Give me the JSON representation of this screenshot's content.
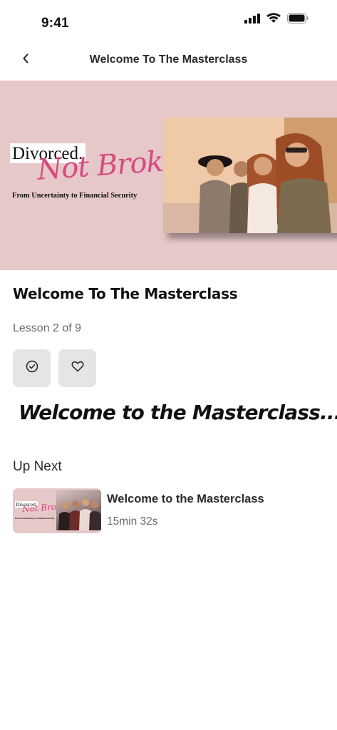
{
  "status_bar": {
    "time": "9:41"
  },
  "nav": {
    "title": "Welcome To The Masterclass"
  },
  "hero": {
    "brand_line1": "Divorced.",
    "brand_script": "Not Broke",
    "tagline": "From Uncertainty to Financial Security"
  },
  "lesson": {
    "title": "Welcome To The Masterclass",
    "progress_text": "Lesson 2 of 9",
    "headline": "Welcome to the Masterclass..."
  },
  "up_next": {
    "label": "Up Next",
    "item": {
      "title": "Welcome to the Masterclass",
      "duration": "15min 32s",
      "thumb_line1": "Divorced.",
      "thumb_script": "Not Broke",
      "thumb_tagline": "From Uncertainty to Financial Security"
    }
  },
  "colors": {
    "hero_bg": "#e7c8c9",
    "brand_pink": "#d4417a",
    "button_bg": "#e5e5e5"
  },
  "icons": [
    "signal-icon",
    "wifi-icon",
    "battery-icon",
    "chevron-left-icon",
    "check-circle-icon",
    "heart-icon"
  ]
}
